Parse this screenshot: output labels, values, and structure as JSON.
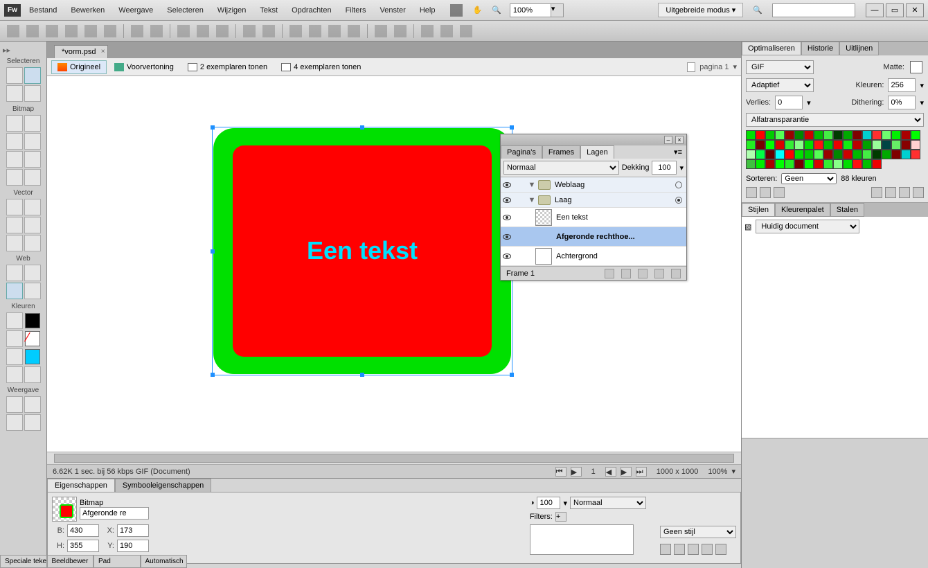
{
  "app": {
    "logo": "Fw"
  },
  "menu": [
    "Bestand",
    "Bewerken",
    "Weergave",
    "Selecteren",
    "Wijzigen",
    "Tekst",
    "Opdrachten",
    "Filters",
    "Venster",
    "Help"
  ],
  "menubar": {
    "zoom": "100%",
    "mode": "Uitgebreide modus"
  },
  "doc": {
    "tab": "*vorm.psd"
  },
  "viewtabs": {
    "orig": "Origineel",
    "prev": "Voorvertoning",
    "two": "2 exemplaren tonen",
    "four": "4 exemplaren tonen",
    "page": "pagina 1"
  },
  "toolpanel": {
    "select": "Selecteren",
    "bitmap": "Bitmap",
    "vector": "Vector",
    "web": "Web",
    "kleuren": "Kleuren",
    "weergave": "Weergave"
  },
  "canvas_text": "Een tekst",
  "status": {
    "info": "6.62K  1 sec. bij 56 kbps  GIF (Document)",
    "frame": "1",
    "dim": "1000 x 1000",
    "zoom": "100%"
  },
  "props": {
    "tab1": "Eigenschappen",
    "tab2": "Symbooleigenschappen",
    "type": "Bitmap",
    "name": "Afgeronde re",
    "B": "430",
    "H": "355",
    "X": "173",
    "Y": "190",
    "opacity": "100",
    "blend": "Normaal",
    "filters": "Filters:",
    "style": "Geen stijl"
  },
  "layers": {
    "tabs": [
      "Pagina's",
      "Frames",
      "Lagen"
    ],
    "blend": "Normaal",
    "dek_label": "Dekking",
    "dek": "100",
    "rows": [
      {
        "type": "folder",
        "name": "Weblaag"
      },
      {
        "type": "folder",
        "name": "Laag",
        "active": true
      },
      {
        "type": "obj",
        "name": "Een tekst",
        "thumb": "text"
      },
      {
        "type": "obj",
        "name": "Afgeronde rechthoe...",
        "thumb": "shape",
        "sel": true
      },
      {
        "type": "obj",
        "name": "Achtergrond",
        "thumb": "bg"
      }
    ],
    "frame": "Frame 1"
  },
  "optimize": {
    "tabs": [
      "Optimaliseren",
      "Historie",
      "Uitlijnen"
    ],
    "format": "GIF",
    "matte": "Matte:",
    "palette": "Adaptief",
    "kleuren_label": "Kleuren:",
    "kleuren": "256",
    "verlies_label": "Verlies:",
    "verlies": "0",
    "dither_label": "Dithering:",
    "dither": "0%",
    "alpha": "Alfatransparantie",
    "sort_label": "Sorteren:",
    "sort": "Geen",
    "count": "88 kleuren",
    "colors": [
      "#00e000",
      "#f00",
      "#0c0",
      "#5f5",
      "#900",
      "#080",
      "#c00",
      "#0b0",
      "#4e4",
      "#003b00",
      "#0a0",
      "#7f0000",
      "#00d0d0",
      "#ff3030",
      "#6fff6f",
      "#0e0",
      "#a00",
      "#0f0",
      "#2e2",
      "#700",
      "#00ff00",
      "#d00",
      "#3e3",
      "#8f8",
      "#0d0",
      "#f11",
      "#00c000",
      "#e00",
      "#1e1",
      "#b00",
      "#00a000",
      "#9f9",
      "#044",
      "#6e6",
      "#800",
      "#ffd0d0",
      "#aeffae",
      "#0f4",
      "#600",
      "#00ffff",
      "#f00",
      "#00e000",
      "#0c0",
      "#5f5",
      "#900",
      "#080",
      "#c00",
      "#0b0",
      "#4e4",
      "#003b00",
      "#0a0",
      "#7f0000",
      "#00d0d0",
      "#ff3030",
      "#40c040",
      "#0e0",
      "#a00",
      "#0f0",
      "#2e2",
      "#700",
      "#00ff00",
      "#d00",
      "#3e3",
      "#8f8",
      "#0d0",
      "#f11",
      "#00c000",
      "#e00"
    ]
  },
  "styles": {
    "tabs": [
      "Stijlen",
      "Kleurenpalet",
      "Stalen"
    ],
    "source": "Huidig document"
  },
  "bottom_tabs": [
    "Speciale tekens",
    "Beeldbewer",
    "Pad",
    "Automatisch"
  ]
}
